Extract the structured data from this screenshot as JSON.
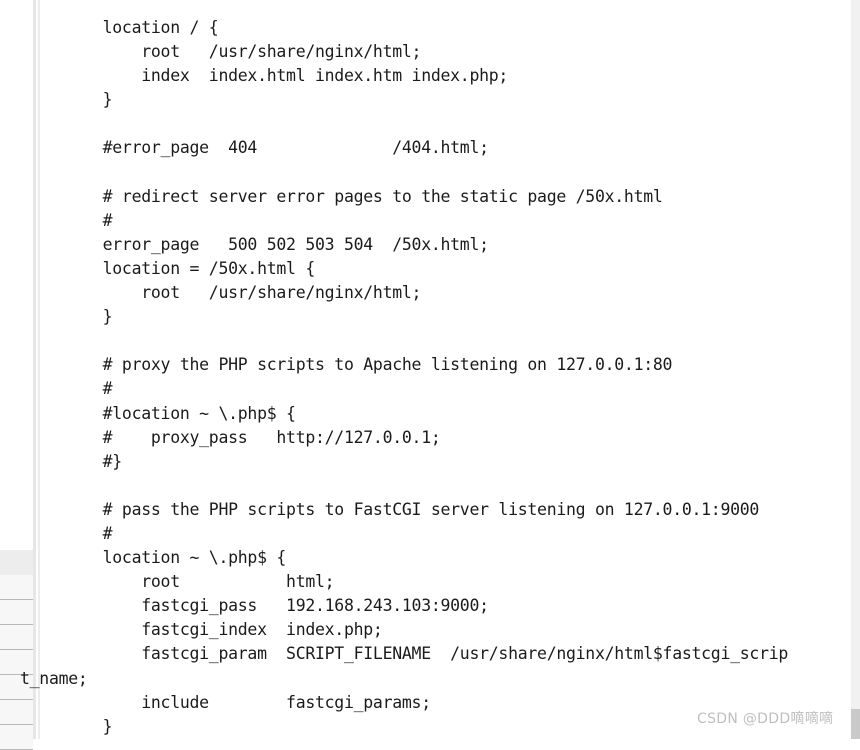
{
  "editor": {
    "language": "nginx-conf",
    "font": "monospace",
    "text_color": "#1b1b1b",
    "background": "#ffffff",
    "gutter_color": "#f7f7f7",
    "rail_color": "#f1f1f1"
  },
  "code": {
    "lines": [
      {
        "text": "    location / {",
        "wrapped": false
      },
      {
        "text": "        root   /usr/share/nginx/html;",
        "wrapped": false
      },
      {
        "text": "        index  index.html index.htm index.php;",
        "wrapped": false
      },
      {
        "text": "    }",
        "wrapped": false
      },
      {
        "text": "",
        "wrapped": false
      },
      {
        "text": "    #error_page  404              /404.html;",
        "wrapped": false
      },
      {
        "text": "",
        "wrapped": false
      },
      {
        "text": "    # redirect server error pages to the static page /50x.html",
        "wrapped": false
      },
      {
        "text": "    #",
        "wrapped": false
      },
      {
        "text": "    error_page   500 502 503 504  /50x.html;",
        "wrapped": false
      },
      {
        "text": "    location = /50x.html {",
        "wrapped": false
      },
      {
        "text": "        root   /usr/share/nginx/html;",
        "wrapped": false
      },
      {
        "text": "    }",
        "wrapped": false
      },
      {
        "text": "",
        "wrapped": false
      },
      {
        "text": "    # proxy the PHP scripts to Apache listening on 127.0.0.1:80",
        "wrapped": false
      },
      {
        "text": "    #",
        "wrapped": false
      },
      {
        "text": "    #location ~ \\.php$ {",
        "wrapped": false
      },
      {
        "text": "    #    proxy_pass   http://127.0.0.1;",
        "wrapped": false
      },
      {
        "text": "    #}",
        "wrapped": false
      },
      {
        "text": "",
        "wrapped": false
      },
      {
        "text": "    # pass the PHP scripts to FastCGI server listening on 127.0.0.1:9000",
        "wrapped": false
      },
      {
        "text": "    #",
        "wrapped": false
      },
      {
        "text": "    location ~ \\.php$ {",
        "wrapped": false
      },
      {
        "text": "        root           html;",
        "wrapped": false
      },
      {
        "text": "        fastcgi_pass   192.168.243.103:9000;",
        "wrapped": false
      },
      {
        "text": "        fastcgi_index  index.php;",
        "wrapped": false
      },
      {
        "text": "        fastcgi_param  SCRIPT_FILENAME  /usr/share/nginx/html$fastcgi_scrip",
        "wrapped": false
      },
      {
        "text": "t_name;",
        "wrapped": true
      },
      {
        "text": "        include        fastcgi_params;",
        "wrapped": false
      },
      {
        "text": "    }",
        "wrapped": false
      }
    ]
  },
  "gutter": {
    "cells": [
      {
        "style": "pale"
      },
      {
        "style": "normal"
      },
      {
        "style": "normal"
      },
      {
        "style": "normal"
      },
      {
        "style": "normal"
      },
      {
        "style": "normal"
      },
      {
        "style": "normal"
      },
      {
        "style": "normal"
      }
    ]
  },
  "watermark": {
    "text": "CSDN @DDD嘀嘀嘀"
  }
}
